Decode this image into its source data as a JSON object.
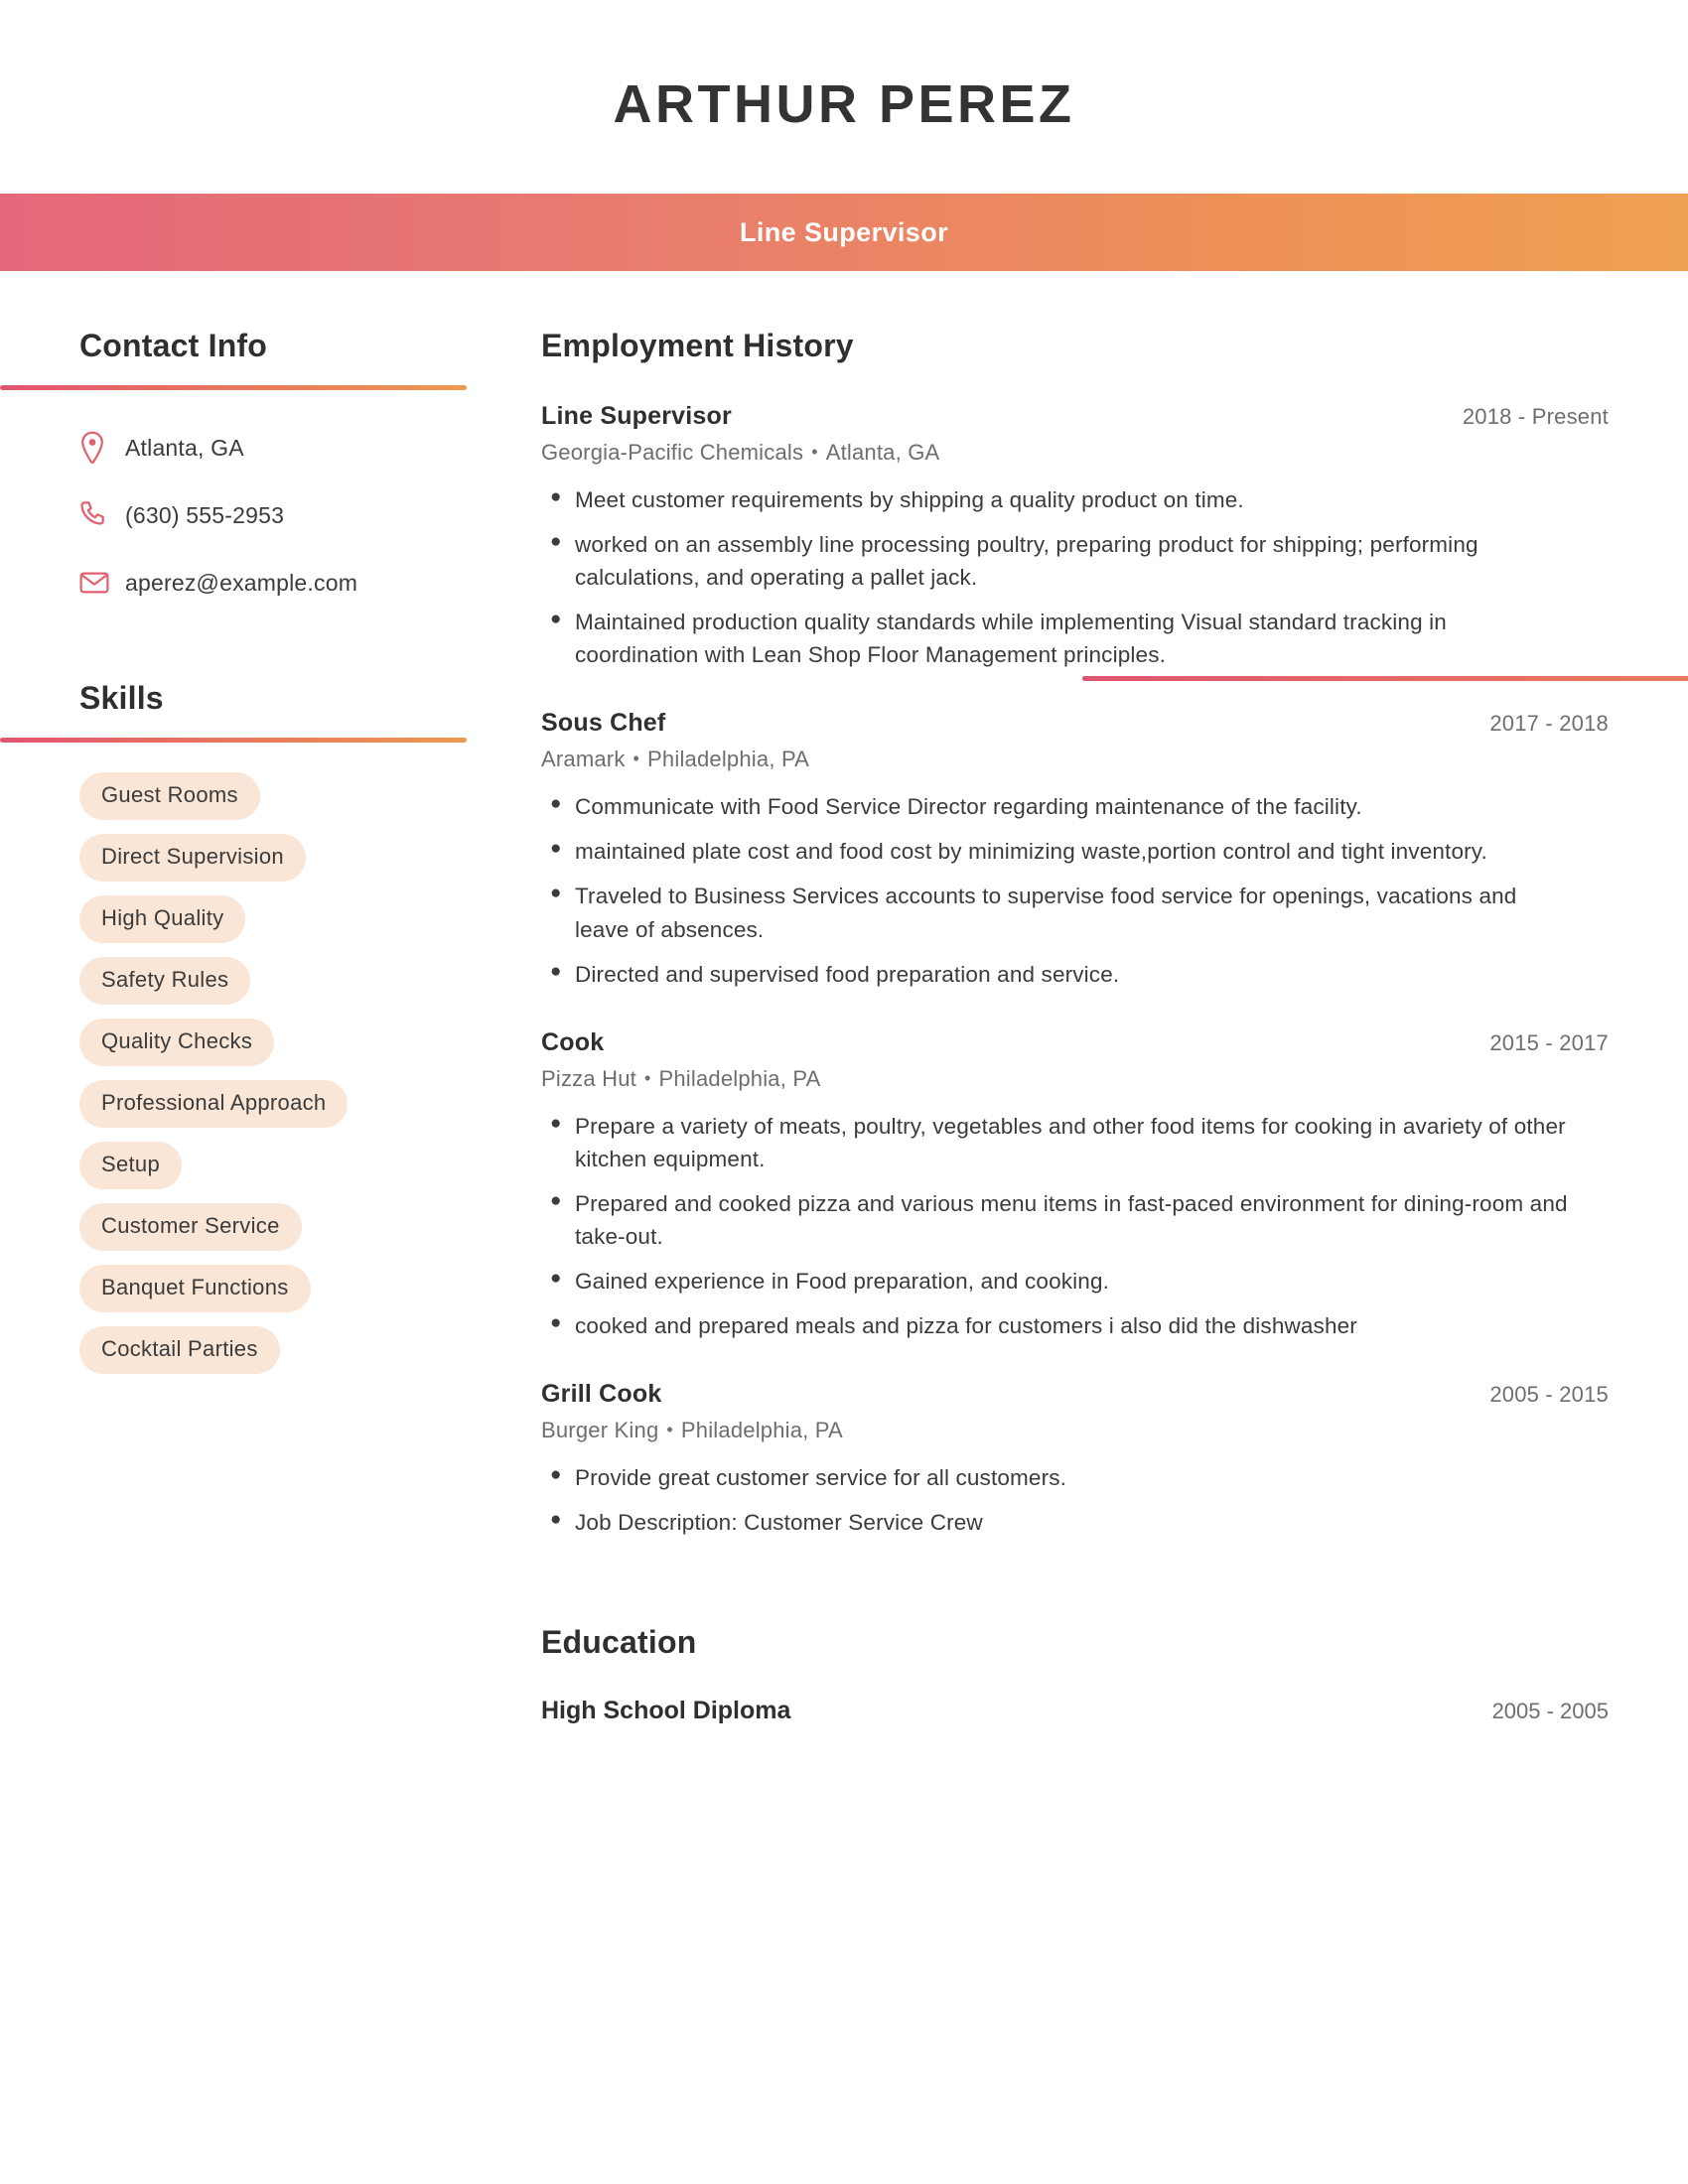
{
  "header": {
    "name": "ARTHUR PEREZ",
    "job_title": "Line Supervisor"
  },
  "theme": {
    "gradient_start": "#e4687a",
    "gradient_end": "#f0a052",
    "pill_bg": "#fae6d7",
    "icon_color": "#e0606f",
    "heading_color": "#2f2f2f",
    "body_color": "#3b3b3b",
    "muted_color": "#6e6e6e"
  },
  "sidebar": {
    "contact": {
      "heading": "Contact Info",
      "items": [
        {
          "icon": "location-pin-icon",
          "value": "Atlanta, GA"
        },
        {
          "icon": "phone-icon",
          "value": "(630) 555-2953"
        },
        {
          "icon": "email-icon",
          "value": "aperez@example.com"
        }
      ]
    },
    "skills": {
      "heading": "Skills",
      "items": [
        "Guest Rooms",
        "Direct Supervision",
        "High Quality",
        "Safety Rules",
        "Quality Checks",
        "Professional Approach",
        "Setup",
        "Customer Service",
        "Banquet Functions",
        "Cocktail Parties"
      ]
    }
  },
  "main": {
    "employment": {
      "heading": "Employment History",
      "jobs": [
        {
          "title": "Line Supervisor",
          "dates": "2018 - Present",
          "company": "Georgia-Pacific Chemicals",
          "separator": "•",
          "location": "Atlanta, GA",
          "bullets": [
            "Meet customer requirements by shipping a quality product on time.",
            "worked on an assembly line processing poultry, preparing product for shipping; performing calculations, and operating a pallet jack.",
            "Maintained production quality standards while implementing Visual standard tracking in coordination with Lean Shop Floor Management principles."
          ]
        },
        {
          "title": "Sous Chef",
          "dates": "2017 - 2018",
          "company": "Aramark",
          "separator": "•",
          "location": "Philadelphia, PA",
          "bullets": [
            "Communicate with Food Service Director regarding maintenance of the facility.",
            "maintained plate cost and food cost by minimizing waste,portion control and tight inventory.",
            "Traveled to Business Services accounts to supervise food service for openings, vacations and leave of absences.",
            "Directed and supervised food preparation and service."
          ]
        },
        {
          "title": "Cook",
          "dates": "2015 - 2017",
          "company": "Pizza Hut",
          "separator": "•",
          "location": "Philadelphia, PA",
          "bullets": [
            "Prepare a variety of meats, poultry, vegetables and other food items for cooking in avariety of other kitchen equipment.",
            "Prepared and cooked pizza and various menu items in fast-paced environment for dining-room and take-out.",
            "Gained experience in Food preparation, and cooking.",
            "cooked and prepared meals and pizza for customers i also did the dishwasher"
          ]
        },
        {
          "title": "Grill Cook",
          "dates": "2005 - 2015",
          "company": "Burger King",
          "separator": "•",
          "location": "Philadelphia, PA",
          "bullets": [
            "Provide great customer service for all customers.",
            "Job Description: Customer Service Crew"
          ]
        }
      ]
    },
    "education": {
      "heading": "Education",
      "entries": [
        {
          "degree": "High School Diploma",
          "dates": "2005 - 2005"
        }
      ]
    }
  }
}
